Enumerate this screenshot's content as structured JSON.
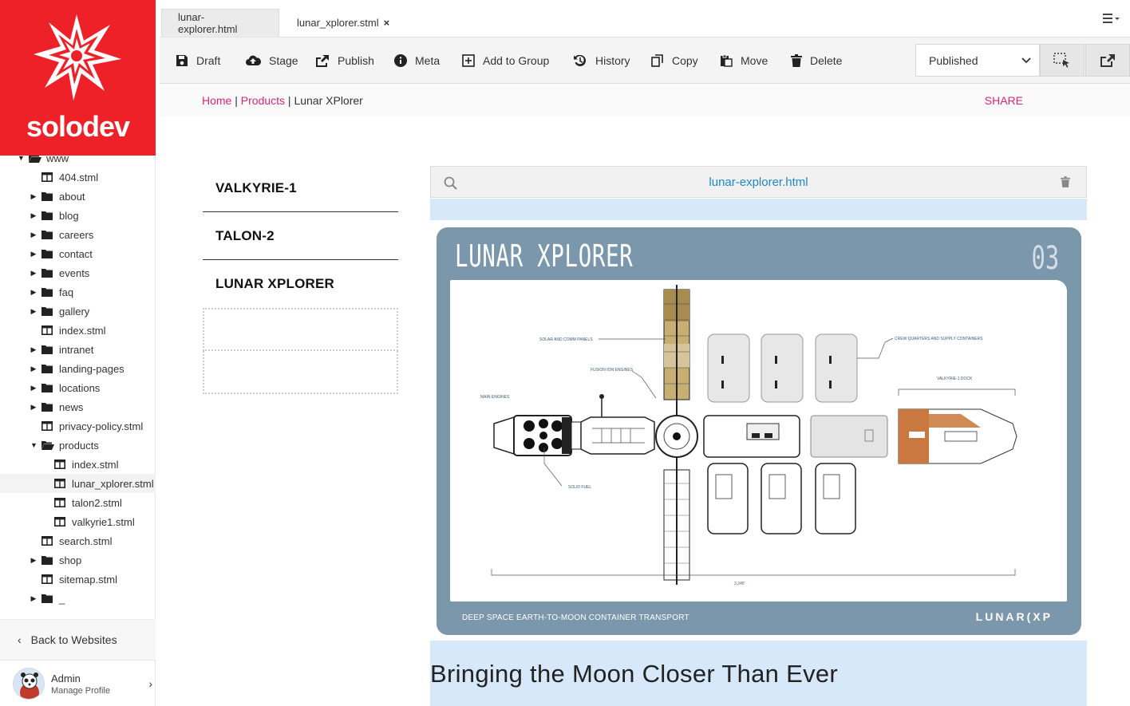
{
  "brand": {
    "logo_text": "solodev",
    "primary_color": "#ee2129",
    "link_color": "#d8257d"
  },
  "tree": [
    {
      "label": "www",
      "type": "folder-open",
      "depth": 0
    },
    {
      "label": "404.stml",
      "type": "page",
      "depth": 1
    },
    {
      "label": "about",
      "type": "folder",
      "depth": 1
    },
    {
      "label": "blog",
      "type": "folder",
      "depth": 1
    },
    {
      "label": "careers",
      "type": "folder",
      "depth": 1
    },
    {
      "label": "contact",
      "type": "folder",
      "depth": 1
    },
    {
      "label": "events",
      "type": "folder",
      "depth": 1
    },
    {
      "label": "faq",
      "type": "folder",
      "depth": 1
    },
    {
      "label": "gallery",
      "type": "folder",
      "depth": 1
    },
    {
      "label": "index.stml",
      "type": "page",
      "depth": 1
    },
    {
      "label": "intranet",
      "type": "folder",
      "depth": 1
    },
    {
      "label": "landing-pages",
      "type": "folder",
      "depth": 1
    },
    {
      "label": "locations",
      "type": "folder",
      "depth": 1
    },
    {
      "label": "news",
      "type": "folder",
      "depth": 1
    },
    {
      "label": "privacy-policy.stml",
      "type": "page",
      "depth": 1
    },
    {
      "label": "products",
      "type": "folder-open",
      "depth": 1
    },
    {
      "label": "index.stml",
      "type": "page",
      "depth": 2
    },
    {
      "label": "lunar_xplorer.stml",
      "type": "page",
      "depth": 2,
      "selected": true
    },
    {
      "label": "talon2.stml",
      "type": "page",
      "depth": 2
    },
    {
      "label": "valkyrie1.stml",
      "type": "page",
      "depth": 2
    },
    {
      "label": "search.stml",
      "type": "page",
      "depth": 1
    },
    {
      "label": "shop",
      "type": "folder",
      "depth": 1
    },
    {
      "label": "sitemap.stml",
      "type": "page",
      "depth": 1
    },
    {
      "label": "_",
      "type": "folder",
      "depth": 1
    }
  ],
  "sidebar": {
    "back_label": "Back to Websites",
    "user_name": "Admin",
    "user_sub": "Manage Profile"
  },
  "tabs": [
    {
      "label": "lunar-explorer.html"
    },
    {
      "label": "lunar_xplorer.stml",
      "close": "×"
    }
  ],
  "toolbar": {
    "draft": "Draft",
    "stage": "Stage",
    "publish": "Publish",
    "meta": "Meta",
    "add_to_group": "Add to Group",
    "history": "History",
    "copy": "Copy",
    "move": "Move",
    "delete": "Delete",
    "status": "Published"
  },
  "breadcrumb": {
    "home": "Home",
    "sep": "|",
    "products": "Products",
    "current": "Lunar XPlorer",
    "share": "SHARE"
  },
  "nav_items": [
    "VALKYRIE-1",
    "TALON-2",
    "LUNAR XPLORER"
  ],
  "file_bar": {
    "filename": "lunar-explorer.html"
  },
  "card": {
    "title": "LUNAR XPLORER",
    "number": "03",
    "footer": "DEEP SPACE EARTH-TO-MOON CONTAINER TRANSPORT",
    "logo": "LUNAR(XP",
    "labels": {
      "solar": "SOLAR AND COMM PANELS",
      "fusion": "FUSION ION ENGINES",
      "main": "MAIN ENGINES",
      "crew": "CREW QUARTERS AND SUPPLY CONTAINERS",
      "dock": "VALKYRIE-1 DOCK",
      "fuel": "SOLID FUEL",
      "length": "3,245'"
    }
  },
  "heading": "Bringing the Moon Closer Than Ever"
}
